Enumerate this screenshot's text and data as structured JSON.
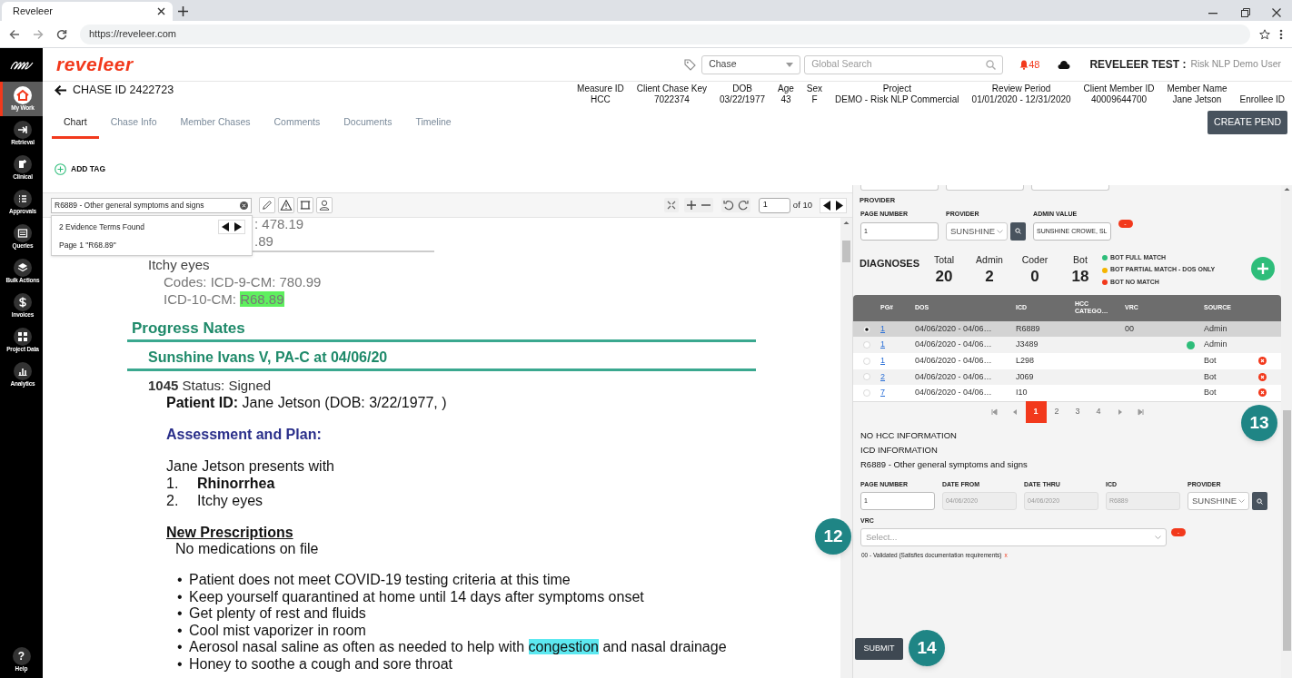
{
  "browser": {
    "tab_title": "Reveleer",
    "url": "https://reveleer.com"
  },
  "sidebar": {
    "items": [
      {
        "label": "My Work",
        "selected": true
      },
      {
        "label": "Retrieval",
        "selected": false
      },
      {
        "label": "Clinical",
        "selected": false
      },
      {
        "label": "Approvals",
        "selected": false
      },
      {
        "label": "Queries",
        "selected": false
      },
      {
        "label": "Bulk Actions",
        "selected": false
      },
      {
        "label": "Invoices",
        "selected": false
      },
      {
        "label": "Project Data",
        "selected": false
      },
      {
        "label": "Analytics",
        "selected": false
      }
    ],
    "help": {
      "icon": "?",
      "label": "Help"
    }
  },
  "header": {
    "logo": "reveleer",
    "search_type": "Chase",
    "search_placeholder": "Global Search",
    "notifications": "48",
    "user_org": "REVELEER TEST :",
    "user_name": "Risk NLP Demo User"
  },
  "chase": {
    "title": "CHASE ID 2422723",
    "meta": [
      {
        "label": "Measure ID",
        "value": "HCC"
      },
      {
        "label": "Client Chase Key",
        "value": "7022374"
      },
      {
        "label": "DOB",
        "value": "03/22/1977"
      },
      {
        "label": "Age",
        "value": "43"
      },
      {
        "label": "Sex",
        "value": "F"
      },
      {
        "label": "Project",
        "value": "DEMO - Risk NLP Commercial"
      },
      {
        "label": "Review Period",
        "value": "01/01/2020 - 12/31/2020"
      },
      {
        "label": "Client Member ID",
        "value": "40009644700"
      },
      {
        "label": "Member Name",
        "value": "Jane Jetson"
      },
      {
        "label": "Enrollee ID"
      }
    ]
  },
  "tabs": [
    {
      "label": "Chart",
      "selected": true
    },
    {
      "label": "Chase Info",
      "selected": false
    },
    {
      "label": "Member Chases",
      "selected": false
    },
    {
      "label": "Comments",
      "selected": false
    },
    {
      "label": "Documents",
      "selected": false
    },
    {
      "label": "Timeline",
      "selected": false
    }
  ],
  "create_pend": "CREATE PEND",
  "add_tag": "ADD TAG",
  "viewer": {
    "search_value": "R6889 - Other general symptoms and signs",
    "evidence_count": "2 Evidence Terms Found",
    "evidence_page": "Page 1 \"R68.89\"",
    "page": "1",
    "page_total": "of 10"
  },
  "document": {
    "lines": [
      {
        "kind": "fragment",
        "text": ": 478.19"
      },
      {
        "kind": "fragment-ruled",
        "text": ".89"
      },
      {
        "kind": "item",
        "text": "Itchy eyes"
      },
      {
        "kind": "code",
        "text": "Codes:  ICD-9-CM:  780.99"
      },
      {
        "kind": "code",
        "text": "ICD-10-CM:  ",
        "highlight": {
          "text": "R68.89",
          "color": "#5ef05e"
        }
      },
      {
        "kind": "heading",
        "text": "Progress Nates"
      },
      {
        "kind": "subheading",
        "text": "Sunshine  Ivans V, PA-C at 04/06/20"
      },
      {
        "kind": "signed",
        "text": "**1045** Status: Signed"
      },
      {
        "kind": "section",
        "text": "**Patient ID:** Jane Jetson (DOB: 3/22/1977, )"
      },
      {
        "kind": "section-title",
        "text": "Assessment and Plan:"
      },
      {
        "kind": "text",
        "text": "Jane Jetson  presents with"
      },
      {
        "kind": "numbered",
        "number": "1.",
        "text": "**Rhinorrhea**"
      },
      {
        "kind": "numbered",
        "number": "2.",
        "text": "Itchy eyes"
      },
      {
        "kind": "underlined",
        "text": "New Prescriptions"
      },
      {
        "kind": "indent",
        "text": "No medications on file"
      },
      {
        "kind": "bullet",
        "bullet": "•",
        "text": "Patient does not meet COVID-19 testing criteria at this time"
      },
      {
        "kind": "bullet",
        "bullet": "•",
        "text": "Keep yourself quarantined at home until  14 days after symptoms onset"
      },
      {
        "kind": "bullet",
        "bullet": "•",
        "text": "Get plenty of rest and fluids"
      },
      {
        "kind": "bullet",
        "bullet": "•",
        "text": "Cool mist vaporizer in room"
      },
      {
        "kind": "bullet",
        "bullet": "•",
        "text": "Aerosol nasal saline as often as needed to help with ",
        "highlight": {
          "text": "congestion",
          "color": "#5ce8f0"
        },
        "after": " and nasal drainage"
      },
      {
        "kind": "bullet",
        "bullet": "•",
        "text": "Honey to soothe a cough and sore throat"
      }
    ]
  },
  "provider": {
    "heading": "PROVIDER",
    "fields": [
      {
        "label": "PAGE NUMBER",
        "value": "1",
        "kind": "input"
      },
      {
        "label": "PROVIDER",
        "value": "SUNSHINE",
        "kind": "select"
      },
      {
        "label": "ADMIN VALUE",
        "value": "SUNSHINE CROWE, SL",
        "kind": "input"
      }
    ],
    "remove": "-"
  },
  "diagnoses": {
    "title": "DIAGNOSES",
    "stats": [
      {
        "label": "Total",
        "value": "20"
      },
      {
        "label": "Admin",
        "value": "2"
      },
      {
        "label": "Coder",
        "value": "0"
      },
      {
        "label": "Bot",
        "value": "18"
      }
    ],
    "legend": [
      {
        "label": "BOT FULL MATCH",
        "color": "#2ebd7a"
      },
      {
        "label": "BOT PARTIAL MATCH - DOS ONLY",
        "color": "#f5b400"
      },
      {
        "label": "BOT NO MATCH",
        "color": "#f2391c"
      }
    ],
    "columns": [
      "PG#",
      "DOS",
      "ICD",
      "HCC CATEGO…",
      "VRC",
      "SOURCE"
    ],
    "rows": [
      {
        "selected": true,
        "page": "1",
        "dos": "04/06/2020 - 04/06…",
        "icd": "R6889",
        "vrc": "00",
        "source": "Admin",
        "removable": false
      },
      {
        "selected": false,
        "page": "1",
        "dos": "04/06/2020 - 04/06…",
        "icd": "J3489",
        "color": "#2ebd7a",
        "source": "Admin",
        "removable": false
      },
      {
        "selected": false,
        "page": "1",
        "dos": "04/06/2020 - 04/06…",
        "icd": "L298",
        "source": "Bot",
        "removable": true
      },
      {
        "selected": false,
        "page": "2",
        "dos": "04/06/2020 - 04/06…",
        "icd": "J069",
        "source": "Bot",
        "removable": true
      },
      {
        "selected": false,
        "page": "7",
        "dos": "04/06/2020 - 04/06…",
        "icd": "I10",
        "source": "Bot",
        "removable": true
      }
    ],
    "pages": [
      {
        "label": "1",
        "selected": true
      },
      {
        "label": "2",
        "selected": false
      },
      {
        "label": "3",
        "selected": false
      },
      {
        "label": "4",
        "selected": false
      }
    ]
  },
  "icd_info": {
    "lines": [
      "NO HCC INFORMATION",
      "ICD INFORMATION",
      "R6889 - Other general symptoms and signs"
    ],
    "fields": [
      {
        "label": "PAGE NUMBER",
        "value": "1",
        "kind": "input",
        "disabled": false
      },
      {
        "label": "DATE FROM",
        "value": "04/06/2020",
        "kind": "input",
        "disabled": true
      },
      {
        "label": "DATE THRU",
        "value": "04/06/2020",
        "kind": "input",
        "disabled": true
      },
      {
        "label": "ICD",
        "value": "R6889",
        "kind": "input",
        "disabled": true
      },
      {
        "label": "PROVIDER",
        "value": "SUNSHINE",
        "kind": "select",
        "disabled": false
      }
    ],
    "vrc_label": "VRC",
    "vrc_placeholder": "Select...",
    "remove": "-",
    "selected_vrc": "00 - Validated (Satisfies documentation requirements)",
    "selected_vrc_remove": "x"
  },
  "submit": "SUBMIT",
  "callouts": [
    {
      "text": "12"
    },
    {
      "text": "13"
    },
    {
      "text": "14"
    }
  ]
}
